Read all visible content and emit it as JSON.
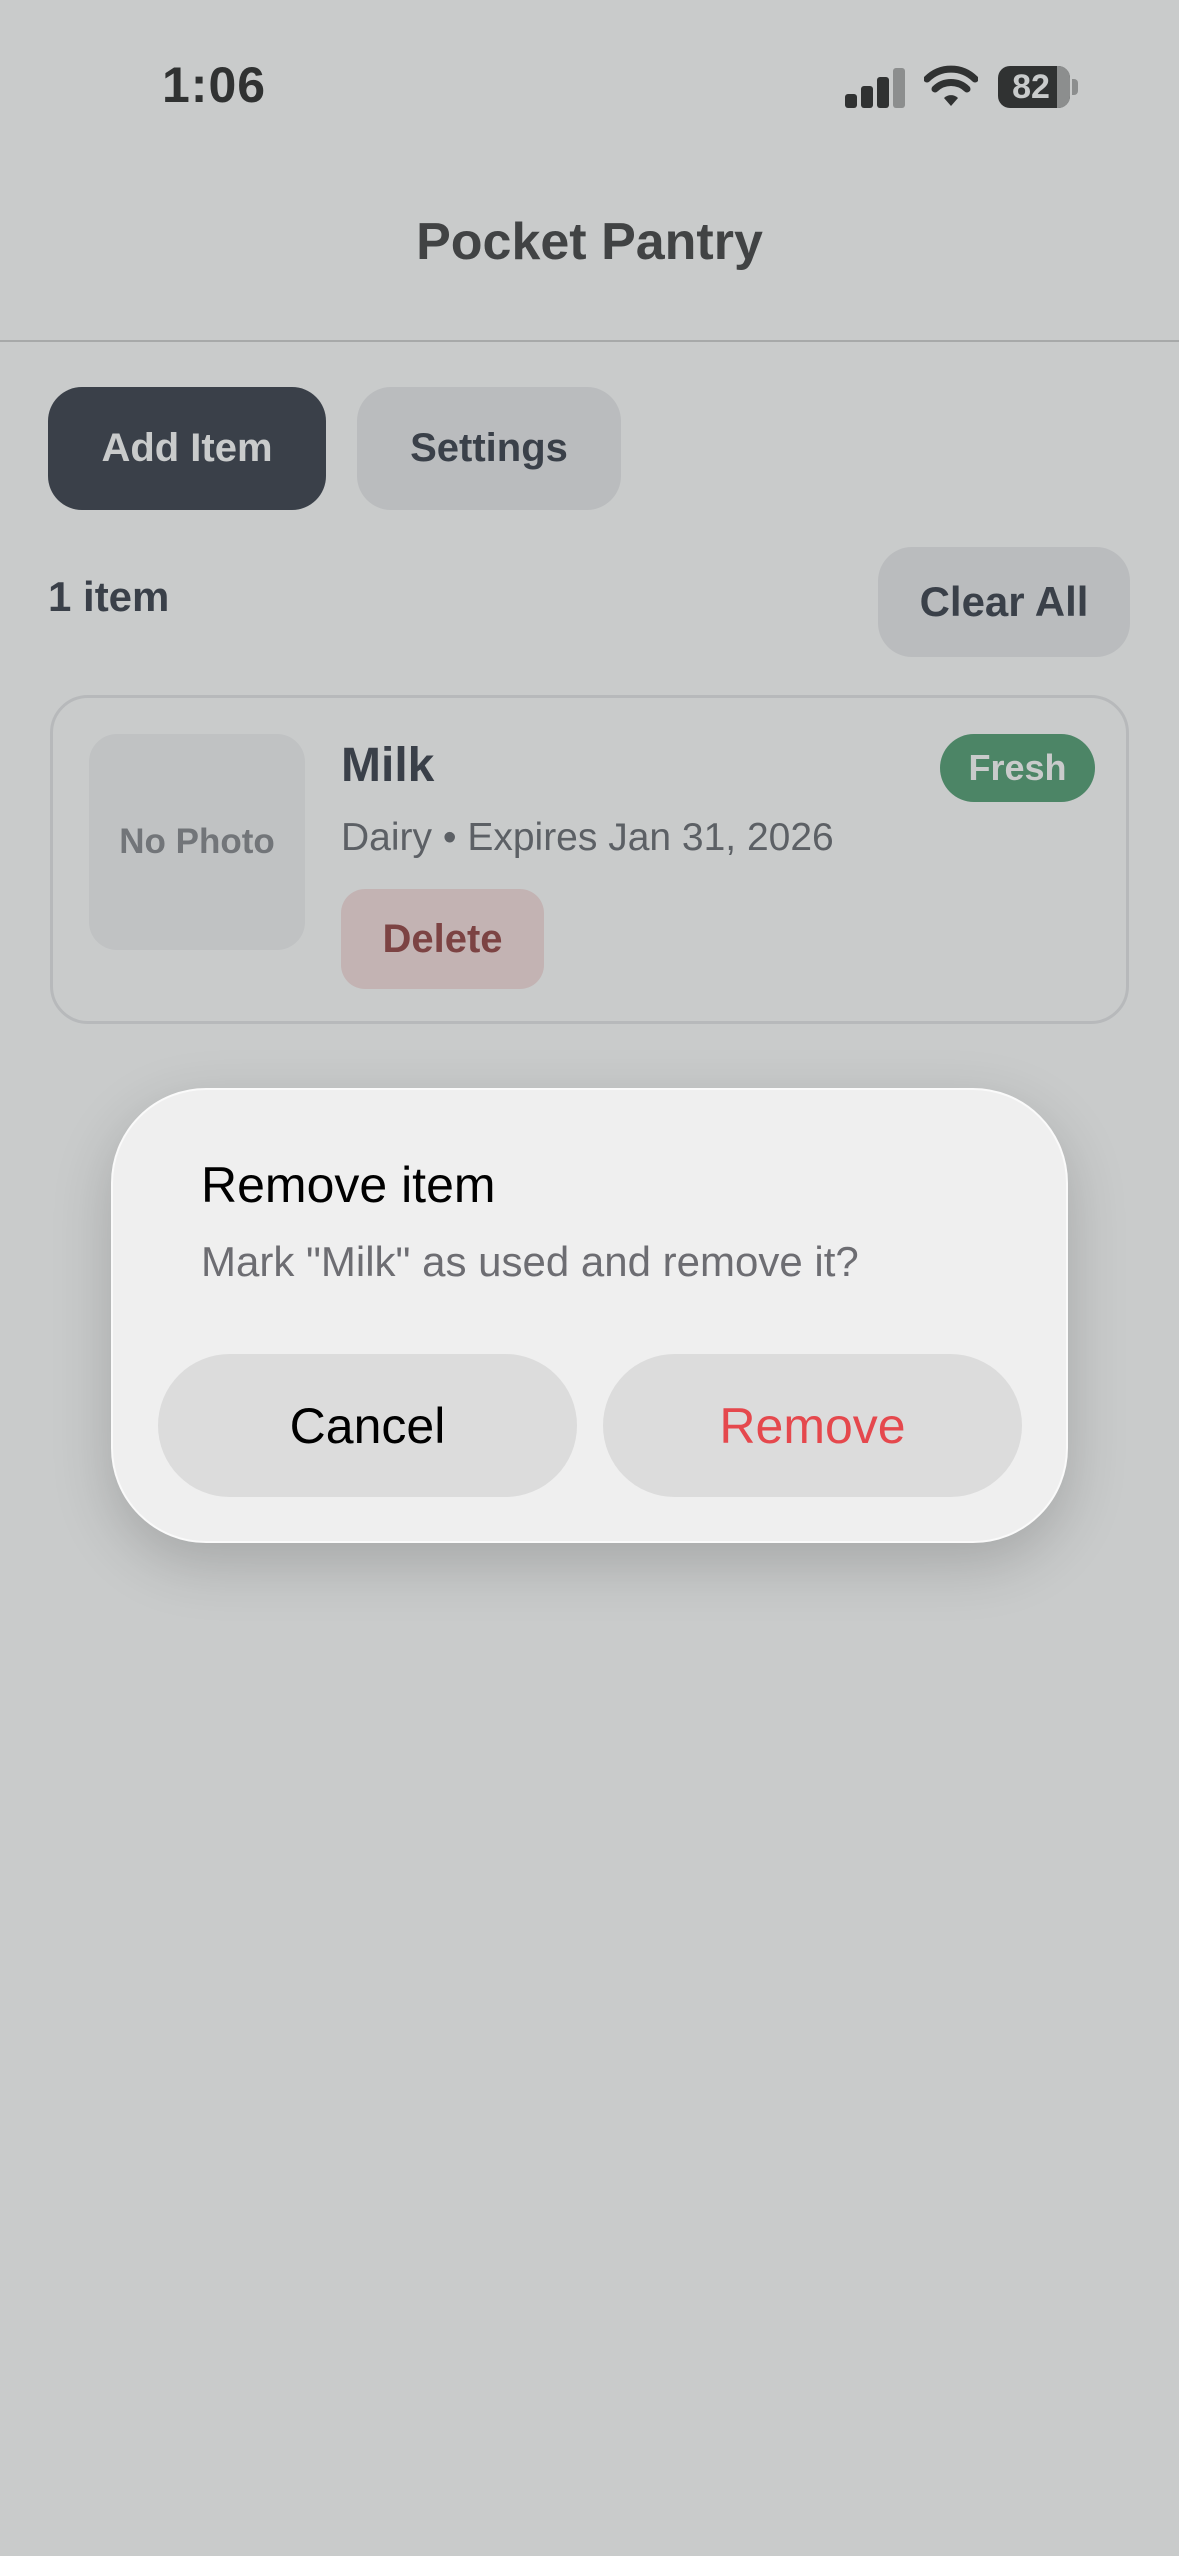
{
  "status_bar": {
    "time": "1:06",
    "battery_level": "82",
    "icons": [
      "signal-icon",
      "wifi-icon",
      "battery-icon"
    ]
  },
  "header": {
    "title": "Pocket Pantry"
  },
  "toolbar": {
    "add_label": "Add Item",
    "settings_label": "Settings"
  },
  "list": {
    "count_label": "1 item",
    "clear_label": "Clear All",
    "items": [
      {
        "photo_placeholder": "No Photo",
        "name": "Milk",
        "meta": "Dairy • Expires Jan 31, 2026",
        "badge": "Fresh",
        "delete_label": "Delete"
      }
    ]
  },
  "dialog": {
    "title": "Remove item",
    "message": "Mark \"Milk\" as used and remove it?",
    "cancel_label": "Cancel",
    "remove_label": "Remove"
  },
  "colors": {
    "primary_button": "#111827",
    "badge_fresh": "#2f8a57",
    "delete_bg": "#f6d7d7",
    "delete_text": "#7f1d1d",
    "destructive": "#e5484d"
  }
}
